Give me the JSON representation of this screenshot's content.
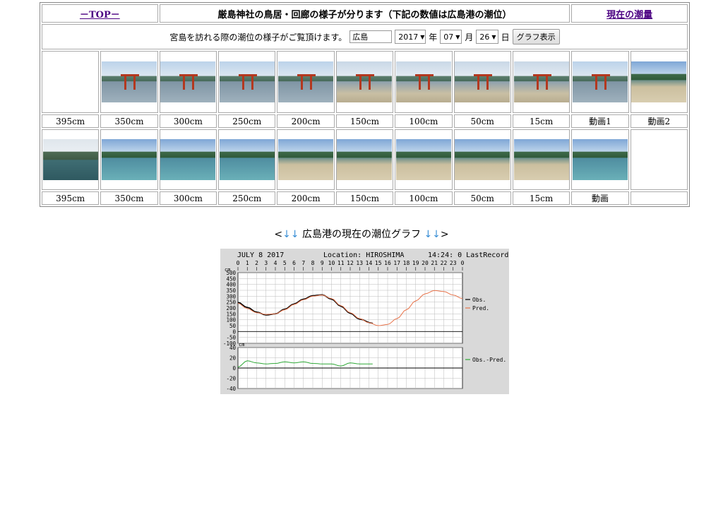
{
  "header": {
    "top_link": "－TOP－",
    "title": "厳島神社の鳥居・回廊の様子が分ります（下記の数値は広島港の潮位）",
    "current_link": "現在の潮量"
  },
  "form": {
    "intro": "宮島を訪れる際の潮位の様子がご覧頂けます。",
    "location_value": "広島",
    "year": "2017",
    "year_unit": "年",
    "month": "07",
    "month_unit": "月",
    "day": "26",
    "day_unit": "日",
    "button": "グラフ表示"
  },
  "row1_labels": [
    "395cm",
    "350cm",
    "300cm",
    "250cm",
    "200cm",
    "150cm",
    "100cm",
    "50cm",
    "15cm",
    "動画1",
    "動画2"
  ],
  "row2_labels": [
    "395cm",
    "350cm",
    "300cm",
    "250cm",
    "200cm",
    "150cm",
    "100cm",
    "50cm",
    "15cm",
    "動画",
    ""
  ],
  "caption": {
    "left_arrows": "↓↓",
    "text": "広島港の現在の潮位グラフ",
    "right_arrows": "↓↓",
    "lt": "<",
    "gt": ">"
  },
  "chart_data": {
    "type": "line",
    "header_date": "JULY 8  2017",
    "header_location": "Location: HIROSHIMA",
    "header_time": "14:24: 0 LastRecord",
    "hours": [
      "0",
      "1",
      "2",
      "3",
      "4",
      "5",
      "6",
      "7",
      "8",
      "9",
      "10",
      "11",
      "12",
      "13",
      "14",
      "15",
      "16",
      "17",
      "18",
      "19",
      "20",
      "21",
      "22",
      "23",
      "0"
    ],
    "upper_unit": "cm",
    "upper_ylim": [
      -100,
      500
    ],
    "upper_ticks": [
      "500",
      "450",
      "400",
      "350",
      "300",
      "250",
      "200",
      "150",
      "100",
      "50",
      "0",
      "-50",
      "-100"
    ],
    "lower_unit": "cm",
    "lower_ylim": [
      -40,
      40
    ],
    "lower_ticks": [
      "40",
      "20",
      "0",
      "-20",
      "-40"
    ],
    "grid": true,
    "colors": {
      "obs": "#000000",
      "pred": "#e8744c",
      "diff": "#2ea836"
    },
    "series": [
      {
        "name": "Obs.",
        "x": [
          0,
          1,
          2,
          3,
          4,
          5,
          6,
          7,
          8,
          9,
          10,
          11,
          12,
          13,
          14.4
        ],
        "values": [
          248,
          205,
          165,
          140,
          150,
          190,
          235,
          275,
          305,
          312,
          275,
          215,
          155,
          105,
          70
        ]
      },
      {
        "name": "Pred.",
        "x": [
          0,
          1,
          2,
          3,
          4,
          5,
          6,
          7,
          8,
          9,
          10,
          11,
          12,
          13,
          14,
          15,
          16,
          17,
          18,
          19,
          20,
          21,
          22,
          23,
          24
        ],
        "values": [
          240,
          195,
          160,
          145,
          150,
          185,
          230,
          270,
          300,
          310,
          280,
          220,
          160,
          110,
          75,
          50,
          60,
          110,
          185,
          260,
          320,
          348,
          340,
          310,
          280
        ]
      },
      {
        "name": "Obs.-Pred.",
        "panel": "lower",
        "x": [
          0,
          1,
          2,
          3,
          4,
          5,
          6,
          7,
          8,
          9,
          10,
          11,
          12,
          13,
          14.4
        ],
        "values": [
          2,
          14,
          10,
          8,
          9,
          12,
          10,
          12,
          9,
          8,
          8,
          4,
          10,
          8,
          8
        ]
      }
    ]
  }
}
